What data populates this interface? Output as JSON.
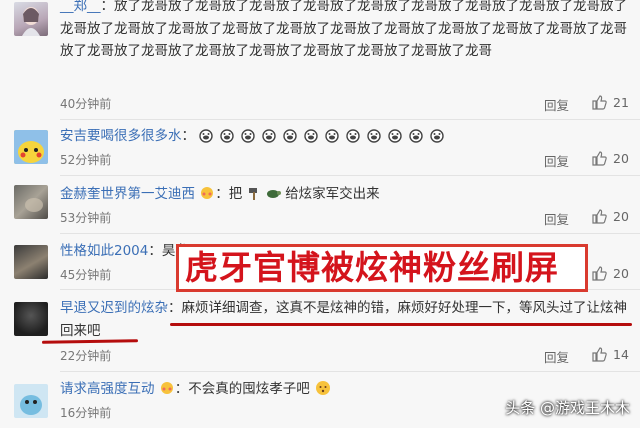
{
  "comments": [
    {
      "user": "__郑__",
      "sep": "：",
      "text": "放了龙哥放了龙哥放了龙哥放了龙哥放了龙哥放了龙哥放了龙哥放了龙哥放了龙哥放了龙哥放了龙哥放了龙哥放了龙哥放了龙哥放了龙哥放了龙哥放了龙哥放了龙哥放了龙哥放了龙哥放了龙哥放了龙哥放了龙哥放了龙哥放了龙哥放了龙哥放了龙哥放了龙哥",
      "time": "40分钟前",
      "reply": "回复",
      "likes": "21"
    },
    {
      "user": "安吉要喝很多很多水",
      "sep": "：",
      "text": "",
      "emoji_icon": "pig-face-icon",
      "time": "52分钟前",
      "reply": "回复",
      "likes": "20"
    },
    {
      "user": "金赫奎世界第一艾迪西",
      "sep": "：把",
      "text": "给炫家军交出来",
      "time": "53分钟前",
      "reply": "回复",
      "likes": "20"
    },
    {
      "user": "性格如此2004",
      "sep": "：昊龙",
      "text": "",
      "time": "45分钟前",
      "reply": "回复",
      "likes": "20"
    },
    {
      "user": "早退又迟到的炫杂",
      "sep": "：",
      "text": "麻烦详细调查，这真不是炫神的错，麻烦好好处理一下，等风头过了让炫神回来吧",
      "time": "22分钟前",
      "reply": "回复",
      "likes": "14"
    },
    {
      "user": "请求高强度互动",
      "sep": "：",
      "text": "不会真的囤炫孝子吧",
      "time": "16分钟前",
      "reply": "回复",
      "likes": ""
    }
  ],
  "overlay": {
    "headline": "虎牙官博被炫神粉丝刷屏"
  },
  "watermark": "头条 @游戏王木木",
  "colors": {
    "username": "#3b6fb6",
    "headline": "#d4141c",
    "underline": "#b50d0d"
  }
}
